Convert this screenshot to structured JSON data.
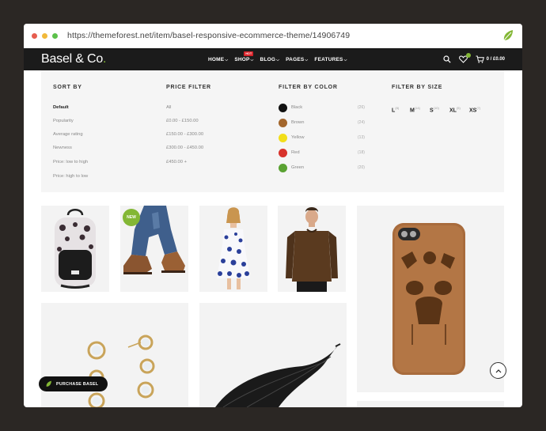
{
  "browser": {
    "url": "https://themeforest.net/item/basel-responsive-ecommerce-theme/14906749",
    "dots": [
      "#e65d4f",
      "#f1b93b",
      "#5cc14b"
    ]
  },
  "nav": {
    "logo_text": "Basel & Co",
    "logo_dot": ".",
    "menu": [
      {
        "label": "HOME"
      },
      {
        "label": "SHOP",
        "badge": "HOT"
      },
      {
        "label": "BLOG"
      },
      {
        "label": "PAGES"
      },
      {
        "label": "FEATURES"
      }
    ],
    "cart_label": "0 / £0.00",
    "search_icon": "search-icon",
    "wishlist_icon": "heart-icon",
    "cart_icon": "cart-icon"
  },
  "filters": {
    "sort_by": {
      "title": "SORT BY",
      "options": [
        "Default",
        "Popularity",
        "Average rating",
        "Newness",
        "Price: low to high",
        "Price: high to low"
      ]
    },
    "price": {
      "title": "PRICE FILTER",
      "options": [
        "All",
        "£0.00 - £150.00",
        "£150.00 - £300.00",
        "£300.00 - £450.00",
        "£450.00 +"
      ]
    },
    "color": {
      "title": "FILTER BY COLOR",
      "options": [
        {
          "name": "Black",
          "count": "(26)",
          "color": "#111111"
        },
        {
          "name": "Brown",
          "count": "(24)",
          "color": "#a3662c"
        },
        {
          "name": "Yellow",
          "count": "(13)",
          "color": "#f2de1a"
        },
        {
          "name": "Red",
          "count": "(18)",
          "color": "#d8332c"
        },
        {
          "name": "Green",
          "count": "(20)",
          "color": "#5aa232"
        }
      ]
    },
    "size": {
      "title": "FILTER BY SIZE",
      "options": [
        {
          "label": "L",
          "count": "(8)"
        },
        {
          "label": "M",
          "count": "(14)"
        },
        {
          "label": "S",
          "count": "(10)"
        },
        {
          "label": "XL",
          "count": "(5)"
        },
        {
          "label": "XS",
          "count": "(7)"
        }
      ]
    }
  },
  "products": {
    "new_badge": "NEW"
  },
  "purchase_button": "PURCHASE BASEL",
  "accent_color": "#83b735"
}
